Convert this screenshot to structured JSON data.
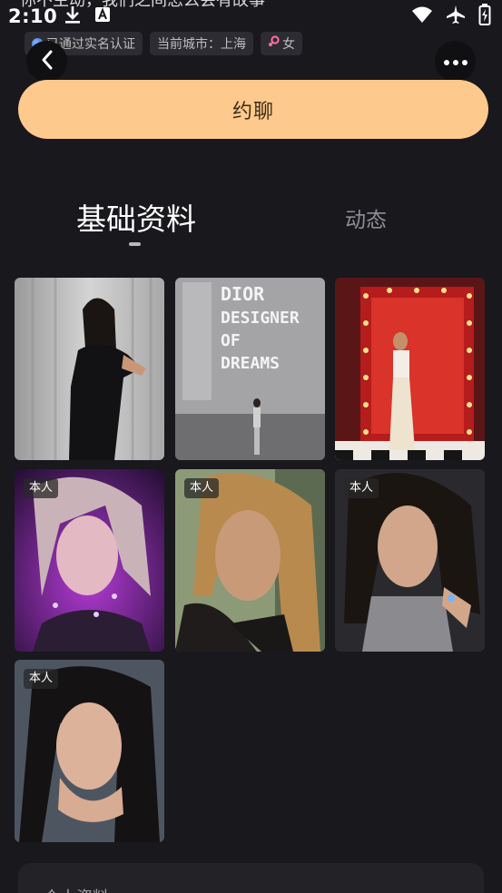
{
  "status_bar": {
    "time": "2:10",
    "slogan": "你不主动，我们之间怎么会有故事",
    "icons": [
      "download-icon",
      "a-icon",
      "wifi-icon",
      "airplane-icon",
      "battery-icon"
    ]
  },
  "tags": [
    {
      "label": "已通过实名认证",
      "icon": "verified-icon"
    },
    {
      "label": "当前城市：上海"
    },
    {
      "label": "女",
      "icon": "female-icon"
    }
  ],
  "chat_button": {
    "label": "约聊"
  },
  "tabs": [
    {
      "label": "基础资料",
      "active": true
    },
    {
      "label": "动态",
      "active": false
    }
  ],
  "photos": [
    {
      "badge": ""
    },
    {
      "badge": ""
    },
    {
      "badge": ""
    },
    {
      "badge": "本人"
    },
    {
      "badge": "本人"
    },
    {
      "badge": "本人"
    },
    {
      "badge": "本人"
    }
  ],
  "profile_card": {
    "title": "个人资料"
  },
  "colors": {
    "background": "#19181d",
    "accent_button": "#fec98c",
    "tag_background": "#2d2c33"
  }
}
